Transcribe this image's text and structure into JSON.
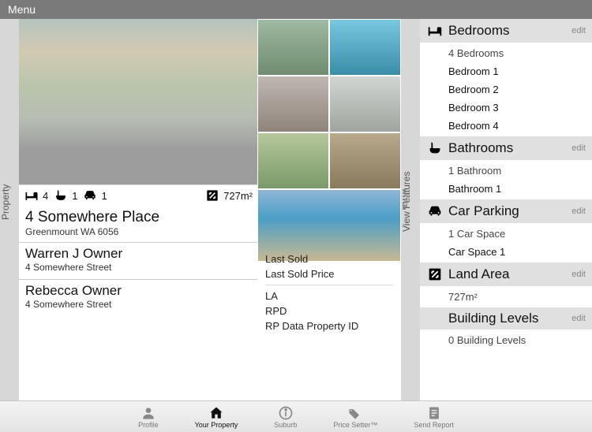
{
  "menu_label": "Menu",
  "rails": {
    "property": "Property",
    "view_features": "View Features"
  },
  "stats": {
    "beds": "4",
    "baths": "1",
    "cars": "1",
    "land": "727m²"
  },
  "address": {
    "line1": "4 Somewhere Place",
    "line2": "Greenmount WA 6056"
  },
  "owners": [
    {
      "name": "Warren J Owner",
      "street": "4 Somewhere Street"
    },
    {
      "name": "Rebecca Owner",
      "street": "4 Somewhere Street"
    }
  ],
  "meta": {
    "last_sold": "Last Sold",
    "last_sold_price": "Last Sold Price",
    "la": "LA",
    "rpd": "RPD",
    "rp_id": "RP Data Property ID"
  },
  "features": {
    "edit_label": "edit",
    "bedrooms": {
      "title": "Bedrooms",
      "summary": "4 Bedrooms",
      "items": [
        "Bedroom 1",
        "Bedroom 2",
        "Bedroom 3",
        "Bedroom 4"
      ]
    },
    "bathrooms": {
      "title": "Bathrooms",
      "summary": "1 Bathroom",
      "items": [
        "Bathroom 1"
      ]
    },
    "car": {
      "title": "Car Parking",
      "summary": "1 Car Space",
      "items": [
        "Car Space 1"
      ]
    },
    "land": {
      "title": "Land Area",
      "summary": "727m²"
    },
    "building": {
      "title": "Building Levels",
      "summary": "0 Building Levels"
    }
  },
  "tabs": {
    "profile": "Profile",
    "your_property": "Your Property",
    "suburb": "Suburb",
    "price_setter": "Price Setter™",
    "send_report": "Send Report"
  }
}
